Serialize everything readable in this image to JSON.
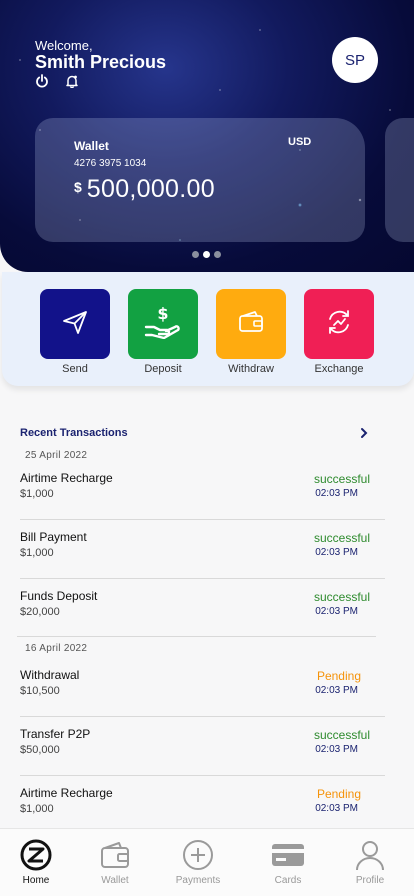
{
  "header": {
    "greeting": "Welcome,",
    "user_name": "Smith Precious",
    "avatar_initials": "SP",
    "icons": [
      "power-icon",
      "bell-icon"
    ]
  },
  "wallet_card": {
    "title": "Wallet",
    "number": "4276 3975 1034",
    "currency": "USD",
    "currency_symbol": "$",
    "balance": "500,000.00",
    "carousel_active_index": 1,
    "carousel_count": 3
  },
  "actions": [
    {
      "label": "Send",
      "icon": "send-icon",
      "color": "#12128a"
    },
    {
      "label": "Deposit",
      "icon": "deposit-icon",
      "color": "#12a142"
    },
    {
      "label": "Withdraw",
      "icon": "wallet-icon",
      "color": "#ffab0f"
    },
    {
      "label": "Exchange",
      "icon": "exchange-icon",
      "color": "#f01f55"
    }
  ],
  "transactions": {
    "title": "Recent Transactions",
    "groups": [
      {
        "date": "25  April 2022",
        "items": [
          {
            "name": "Airtime Recharge",
            "amount": "$1,000",
            "status": "successful",
            "time": "02:03 PM"
          },
          {
            "name": "Bill Payment",
            "amount": "$1,000",
            "status": "successful",
            "time": "02:03 PM"
          },
          {
            "name": "Funds Deposit",
            "amount": "$20,000",
            "status": "successful",
            "time": "02:03 PM"
          }
        ]
      },
      {
        "date": "16  April 2022",
        "items": [
          {
            "name": "Withdrawal",
            "amount": "$10,500",
            "status": "Pending",
            "time": "02:03 PM"
          },
          {
            "name": "Transfer P2P",
            "amount": "$50,000",
            "status": "successful",
            "time": "02:03 PM"
          },
          {
            "name": "Airtime Recharge",
            "amount": "$1,000",
            "status": "Pending",
            "time": "02:03 PM"
          }
        ]
      }
    ]
  },
  "tabbar": [
    {
      "label": "Home",
      "icon": "home-logo-icon",
      "active": true
    },
    {
      "label": "Wallet",
      "icon": "wallet-icon",
      "active": false
    },
    {
      "label": "Payments",
      "icon": "plus-circle-icon",
      "active": false
    },
    {
      "label": "Cards",
      "icon": "card-icon",
      "active": false
    },
    {
      "label": "Profile",
      "icon": "user-icon",
      "active": false
    }
  ],
  "colors": {
    "brand_navy": "#1b2370",
    "success": "#2e8b2e",
    "pending": "#f5930a"
  }
}
